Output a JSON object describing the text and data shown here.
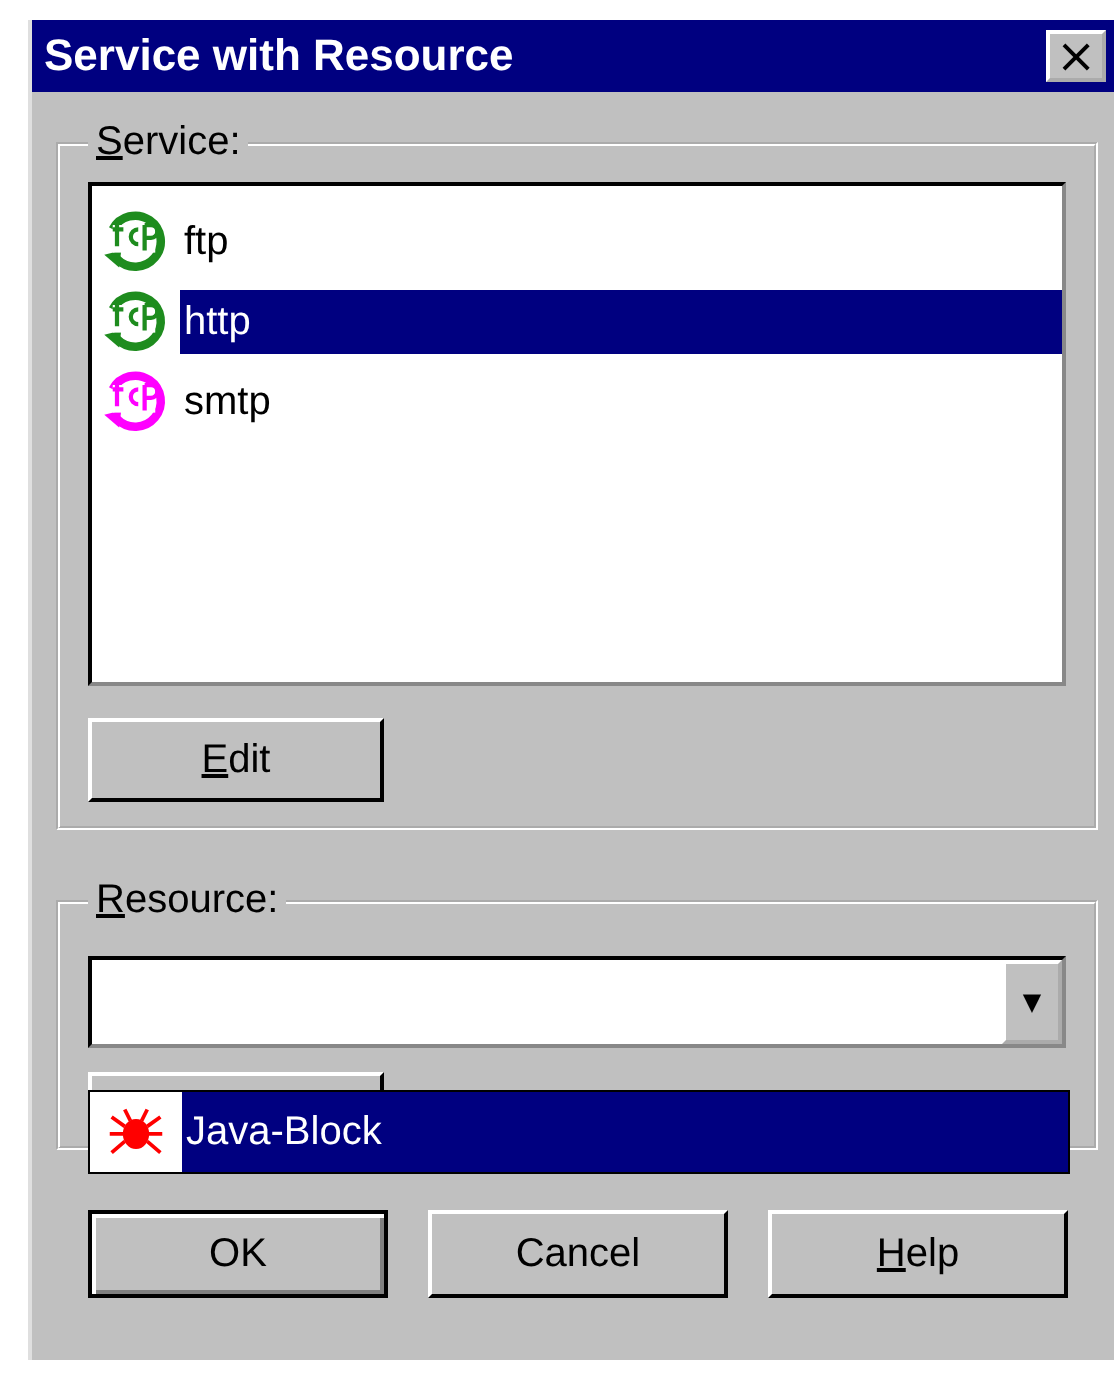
{
  "window": {
    "title": "Service with Resource",
    "close": "×"
  },
  "service": {
    "label": {
      "key": "S",
      "text": "ervice:"
    },
    "items": [
      {
        "name": "ftp",
        "color": "#1e8c1e",
        "selected": false
      },
      {
        "name": "http",
        "color": "#1e8c1e",
        "selected": true
      },
      {
        "name": "smtp",
        "color": "#ff00ff",
        "selected": false
      }
    ],
    "edit_button": {
      "key": "E",
      "text": "dit"
    }
  },
  "resource": {
    "label": {
      "key": "R",
      "text": "esource:"
    },
    "value_placeholder_arrow": "▼",
    "dropdown": [
      {
        "name": "Java-Block",
        "selected": true
      }
    ]
  },
  "buttons": [
    {
      "text": "OK",
      "default": true
    },
    {
      "text": "Cancel",
      "default": false
    },
    {
      "key": "H",
      "text": "elp",
      "default": false
    }
  ]
}
